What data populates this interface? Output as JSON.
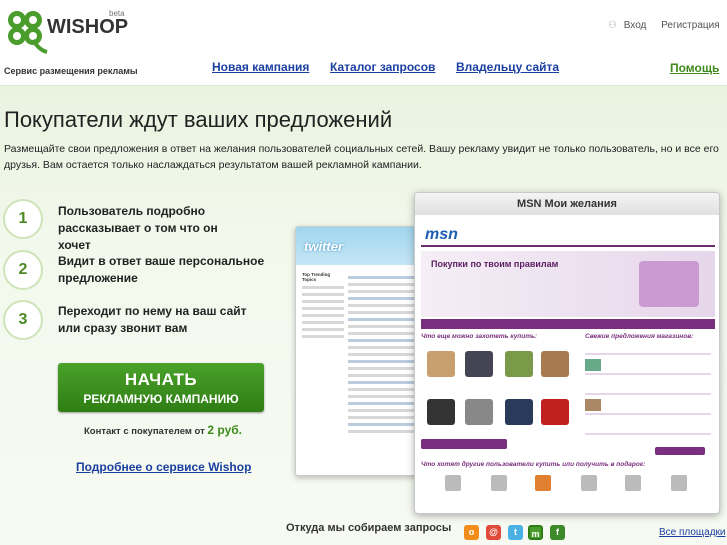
{
  "header": {
    "brand": "WISHOP",
    "beta": "beta",
    "tagline": "Сервис размещения рекламы",
    "nav": [
      "Новая кампания",
      "Каталог запросов",
      "Владельцу сайта"
    ],
    "login": "Вход",
    "register": "Регистрация",
    "help": "Помощь"
  },
  "main": {
    "headline": "Покупатели ждут ваших предложений",
    "lead": "Размещайте свои предложения в ответ на желания пользователей социальных сетей. Вашу рекламу увидит не только пользователь, но и все его друзья. Вам остается только наслаждаться результатом вашей рекламной кампании.",
    "steps": [
      {
        "num": "1",
        "text": "Пользователь подробно рассказывает о том что он хочет"
      },
      {
        "num": "2",
        "text": "Видит в ответ ваше персональное предложение"
      },
      {
        "num": "3",
        "text": "Переходит по нему на ваш сайт или сразу звонит вам"
      }
    ],
    "cta_line1": "НАЧАТЬ",
    "cta_line2": "РЕКЛАМНУЮ КАМПАНИЮ",
    "price_text": "Контакт с покупателем от",
    "price_value": "2 руб.",
    "more_link": "Подробнее о сервисе Wishop"
  },
  "preview": {
    "twitter_brand": "twitter",
    "twitter_section": "Top Trending Topics",
    "msn_title": "MSN Мои желания",
    "msn_logo": "msn",
    "banner_title": "Покупки по твоим правилам",
    "section_left": "Что еще можно захотеть купить:",
    "section_right": "Свежие предложения магазинов:",
    "bottom_label": "Что хотят другие пользователи купить или получить в подарок:"
  },
  "sources": {
    "label": "Откуда мы собираем запросы",
    "all": "Все площадки",
    "icons": [
      {
        "name": "odnoklassniki-icon",
        "color": "#f28c1a"
      },
      {
        "name": "moimir-icon",
        "color": "#e04a3a"
      },
      {
        "name": "twitter-icon",
        "color": "#4bb0e4"
      },
      {
        "name": "msn-icon",
        "color": "#4a9d2d"
      },
      {
        "name": "facebook-icon",
        "color": "#3d8a2a"
      }
    ]
  }
}
